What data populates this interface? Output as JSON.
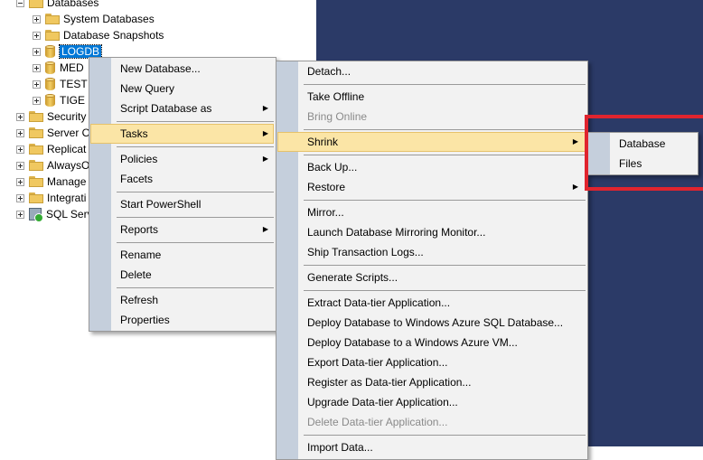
{
  "tree": {
    "databases": "Databases",
    "system_databases": "System Databases",
    "database_snapshots": "Database Snapshots",
    "logdb": "LOGDB",
    "med": "MED",
    "test": "TEST",
    "tige": "TIGE",
    "security": "Security",
    "server_objects": "Server O",
    "replication": "Replicat",
    "always_on": "AlwaysO",
    "management": "Manage",
    "integration": "Integrati",
    "sql_server": "SQL Serv"
  },
  "context_menu": {
    "new_database": "New Database...",
    "new_query": "New Query",
    "script_database_as": "Script Database as",
    "tasks": "Tasks",
    "policies": "Policies",
    "facets": "Facets",
    "start_powershell": "Start PowerShell",
    "reports": "Reports",
    "rename": "Rename",
    "delete": "Delete",
    "refresh": "Refresh",
    "properties": "Properties"
  },
  "tasks_menu": {
    "detach": "Detach...",
    "take_offline": "Take Offline",
    "bring_online": "Bring Online",
    "shrink": "Shrink",
    "back_up": "Back Up...",
    "restore": "Restore",
    "mirror": "Mirror...",
    "launch_mirroring_monitor": "Launch Database Mirroring Monitor...",
    "ship_transaction_logs": "Ship Transaction Logs...",
    "generate_scripts": "Generate Scripts...",
    "extract_data_tier": "Extract Data-tier Application...",
    "deploy_azure_sql": "Deploy Database to Windows Azure SQL Database...",
    "deploy_azure_vm": "Deploy Database to a Windows Azure VM...",
    "export_data_tier": "Export Data-tier Application...",
    "register_data_tier": "Register as Data-tier Application...",
    "upgrade_data_tier": "Upgrade Data-tier Application...",
    "delete_data_tier": "Delete Data-tier Application...",
    "import_data": "Import Data..."
  },
  "shrink_menu": {
    "database": "Database",
    "files": "Files"
  },
  "colors": {
    "highlight": "#fbe5a6",
    "annotation_box": "#e0242e",
    "background_dark": "#2b3a67"
  }
}
